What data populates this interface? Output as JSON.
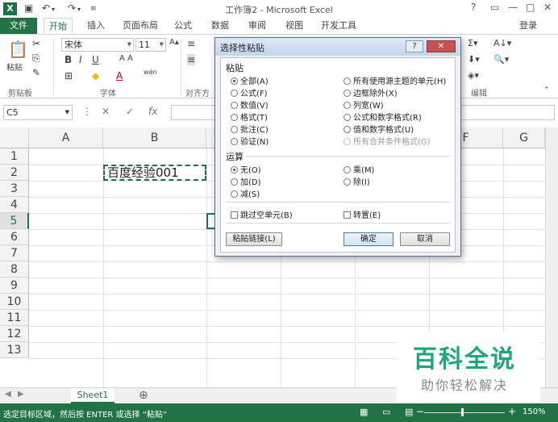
{
  "titlebar": {
    "app_icon": "X",
    "title": "工作簿2 - Microsoft Excel",
    "save_icon": "save-icon",
    "undo_icon": "undo-icon",
    "redo_icon": "redo-icon",
    "help": "?",
    "minimize": "—",
    "restore": "□",
    "close": "✕"
  },
  "ribbon_tabs": {
    "file": "文件",
    "items": [
      "开始",
      "插入",
      "页面布局",
      "公式",
      "数据",
      "审阅",
      "视图",
      "开发工具"
    ],
    "login": "登录"
  },
  "ribbon": {
    "paste_label": "粘贴",
    "clipboard_group": "剪贴板",
    "font_name": "宋体",
    "font_size": "11",
    "font_group": "字体",
    "align_group": "对齐方",
    "edit_group": "编辑",
    "wen": "wén"
  },
  "formula_bar": {
    "name_box": "C5",
    "cancel": "✕",
    "enter": "✓",
    "fx": "fx"
  },
  "grid": {
    "columns": [
      "A",
      "B",
      "C",
      "D",
      "E",
      "F",
      "G"
    ],
    "rows": [
      "1",
      "2",
      "3",
      "4",
      "5",
      "6",
      "7",
      "8",
      "9",
      "10",
      "11",
      "12",
      "13"
    ],
    "cell_b2": "百度经验001",
    "selected_row": "5"
  },
  "sheets": {
    "tabs": [
      "Sheet1"
    ],
    "add": "⊕"
  },
  "status": {
    "message": "选定目标区域，然后按 ENTER 或选择 “粘贴”",
    "zoom": "150%"
  },
  "dialog": {
    "title": "选择性粘贴",
    "help": "?",
    "close": "✕",
    "paste_section": "粘贴",
    "paste_options_left": [
      "全部(A)",
      "公式(F)",
      "数值(V)",
      "格式(T)",
      "批注(C)",
      "验证(N)"
    ],
    "paste_options_right": [
      "所有使用源主题的单元(H)",
      "边框除外(X)",
      "列宽(W)",
      "公式和数字格式(R)",
      "值和数字格式(U)",
      "所有合并条件格式(G)"
    ],
    "operation_section": "运算",
    "op_left": [
      "无(O)",
      "加(D)",
      "减(S)"
    ],
    "op_right": [
      "乘(M)",
      "除(I)"
    ],
    "skip_blanks": "跳过空单元(B)",
    "transpose": "转置(E)",
    "paste_link": "粘贴链接(L)",
    "ok": "确定",
    "cancel": "取消"
  },
  "watermark": {
    "brand": "百科全说",
    "slogan": "助你轻松解决"
  }
}
